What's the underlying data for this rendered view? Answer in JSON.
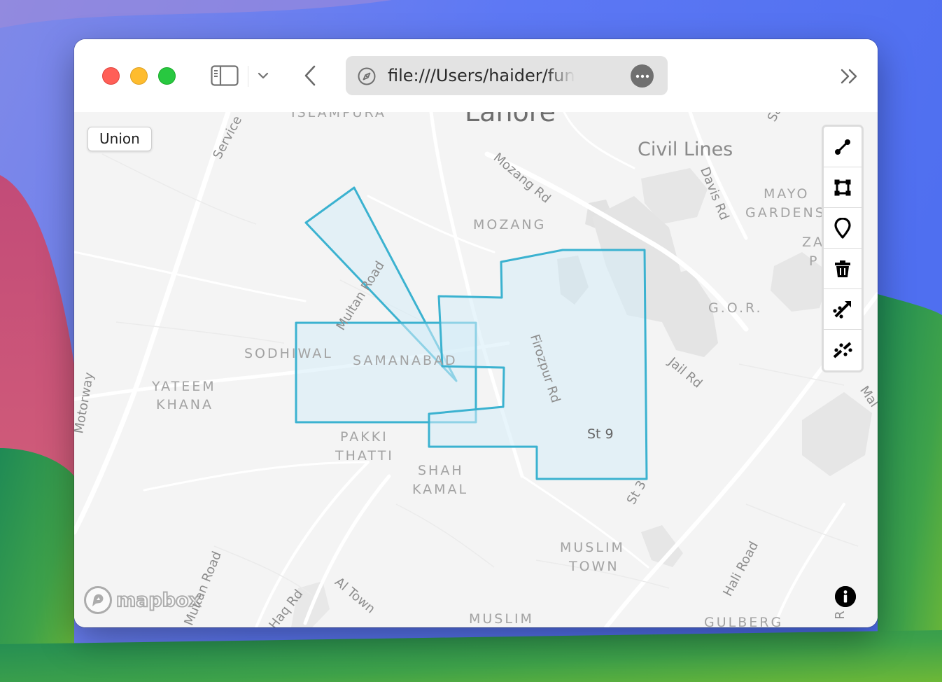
{
  "browser": {
    "address_url": "file:///Users/haider/fun/map",
    "icons": {
      "sidebar": "sidebar-icon",
      "sidebar_menu": "chevron-down-icon",
      "back": "chevron-left-icon",
      "page_info": "compass-icon",
      "page_menu": "ellipsis-icon",
      "overflow": "double-chevron-right-icon"
    }
  },
  "map": {
    "union_button_label": "Union",
    "attribution_logo": "mapbox",
    "labels": {
      "lahore": "Lahore",
      "civil_lines": "Civil Lines",
      "islampura": "ISLAMPURA",
      "mozang": "MOZANG",
      "mayo_gardens_1": "MAYO",
      "mayo_gardens_2": "GARDENS",
      "za_1": "ZA",
      "za_2": "P",
      "gor": "G.O.R.",
      "sodhiwal": "SODHIWAL",
      "samanabad": "SAMANABAD",
      "yateem_khana_1": "YATEEM",
      "yateem_khana_2": "KHANA",
      "pakki_thatti_1": "PAKKI",
      "pakki_thatti_2": "THATTI",
      "shah_kamal_1": "SHAH",
      "shah_kamal_2": "KAMAL",
      "muslim_town_1": "MUSLIM",
      "muslim_town_2": "TOWN",
      "muslim_bottom": "MUSLIM",
      "gulberg": "GULBERG",
      "service_road": "Service",
      "mozang_rd": "Mozang Rd",
      "davis_rd": "Davis Rd",
      "multan_road": "Multan Road",
      "firozpur_rd": "Firozpur Rd",
      "jail_rd": "Jail Rd",
      "st9": "St 9",
      "st3": "St 3",
      "motorway": "Motorway",
      "multan_road_south": "Multan Road",
      "haq_rd": "Haq Rd",
      "al_town": "Al Town",
      "hali_road": "Hali Road",
      "mall_rd": "Mal",
      "sa": "Sa",
      "r_edge": "R"
    },
    "draw_controls": [
      {
        "name": "line-tool-icon"
      },
      {
        "name": "polygon-tool-icon"
      },
      {
        "name": "point-tool-icon"
      },
      {
        "name": "trash-icon"
      },
      {
        "name": "combine-icon"
      },
      {
        "name": "uncombine-icon"
      }
    ],
    "colors": {
      "polygon_stroke": "#3bb2d0",
      "polygon_fill": "#d6ecf7",
      "map_background": "#f4f4f4"
    }
  }
}
